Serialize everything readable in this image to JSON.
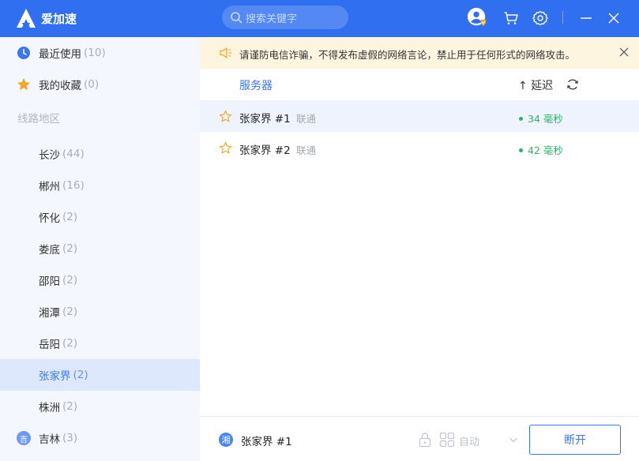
{
  "app": {
    "title": "爱加速"
  },
  "search": {
    "placeholder": "搜索关键字"
  },
  "sidebar": {
    "recent": {
      "label": "最近使用",
      "count": "(10)"
    },
    "favorites": {
      "label": "我的收藏",
      "count": "(0)"
    },
    "section_label": "线路地区",
    "regions": [
      {
        "label": "长沙",
        "count": "(44)"
      },
      {
        "label": "郴州",
        "count": "(16)"
      },
      {
        "label": "怀化",
        "count": "(2)"
      },
      {
        "label": "娄底",
        "count": "(2)"
      },
      {
        "label": "邵阳",
        "count": "(2)"
      },
      {
        "label": "湘潭",
        "count": "(2)"
      },
      {
        "label": "岳阳",
        "count": "(2)"
      },
      {
        "label": "张家界",
        "count": "(2)"
      },
      {
        "label": "株洲",
        "count": "(2)"
      }
    ],
    "province": {
      "badge": "吉",
      "label": "吉林",
      "count": "(3)"
    }
  },
  "notice": {
    "text": "请谨防电信诈骗，不得发布虚假的网络言论，禁止用于任何形式的网络攻击。"
  },
  "table": {
    "server_header": "服务器",
    "latency_header": "↑ 延迟",
    "rows": [
      {
        "name": "张家界 #1",
        "isp": "联通",
        "ping": "34 毫秒"
      },
      {
        "name": "张家界 #2",
        "isp": "联通",
        "ping": "42 毫秒"
      }
    ]
  },
  "footer": {
    "badge": "湘",
    "current": "张家界 #1",
    "mode": "自动",
    "disconnect": "断开"
  },
  "colors": {
    "brand": "#2f6ff0",
    "accent": "#3a77ee",
    "ping_green": "#25b864",
    "star": "#f5a623"
  }
}
